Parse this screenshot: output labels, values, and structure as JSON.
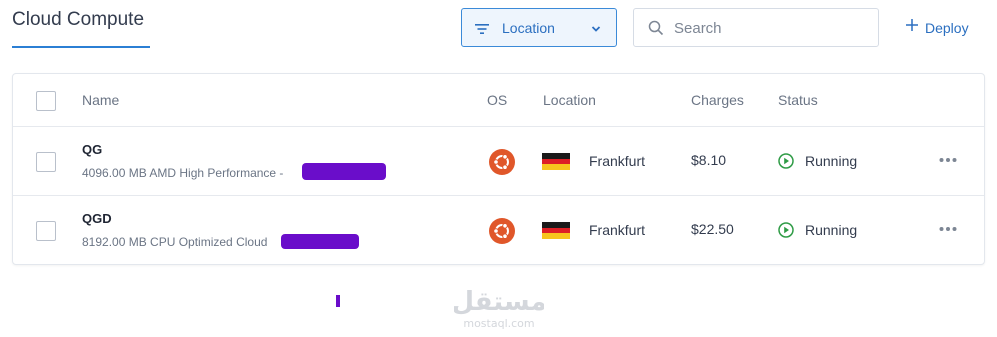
{
  "page": {
    "title": "Cloud Compute"
  },
  "toolbar": {
    "location_filter_label": "Location",
    "search_placeholder": "Search",
    "deploy_label": "Deploy"
  },
  "table": {
    "columns": {
      "name": "Name",
      "os": "OS",
      "location": "Location",
      "charges": "Charges",
      "status": "Status"
    },
    "rows": [
      {
        "name": "QG",
        "description": "4096.00 MB AMD High Performance -",
        "os_icon": "ubuntu-icon",
        "flag": "germany",
        "location": "Frankfurt",
        "charges": "$8.10",
        "status": "Running"
      },
      {
        "name": "QGD",
        "description": "8192.00 MB CPU Optimized Cloud",
        "os_icon": "ubuntu-icon",
        "flag": "germany",
        "location": "Frankfurt",
        "charges": "$22.50",
        "status": "Running"
      }
    ]
  },
  "watermark": {
    "text_arabic": "مستقل",
    "text_latin": "mostaql.com"
  },
  "colors": {
    "accent": "#2b7fd4",
    "running_green": "#2e9b45",
    "ubuntu_orange": "#e0572a",
    "redaction": "#6a0dca"
  }
}
